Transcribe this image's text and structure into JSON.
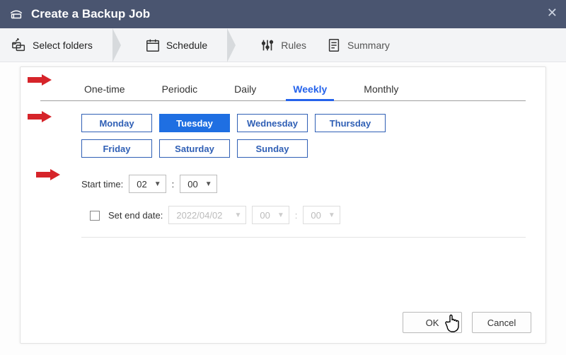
{
  "header": {
    "title": "Create a Backup Job"
  },
  "steps": {
    "selectFolders": "Select folders",
    "schedule": "Schedule",
    "rules": "Rules",
    "summary": "Summary"
  },
  "tabs": {
    "oneTime": "One-time",
    "periodic": "Periodic",
    "daily": "Daily",
    "weekly": "Weekly",
    "monthly": "Monthly"
  },
  "days": {
    "mon": "Monday",
    "tue": "Tuesday",
    "wed": "Wednesday",
    "thu": "Thursday",
    "fri": "Friday",
    "sat": "Saturday",
    "sun": "Sunday"
  },
  "startTime": {
    "label": "Start time:",
    "hour": "02",
    "minute": "00",
    "separator": ":"
  },
  "endDate": {
    "label": "Set end date:",
    "date": "2022/04/02",
    "hour": "00",
    "minute": "00",
    "separator": ":"
  },
  "footer": {
    "ok": "OK",
    "cancel": "Cancel"
  }
}
